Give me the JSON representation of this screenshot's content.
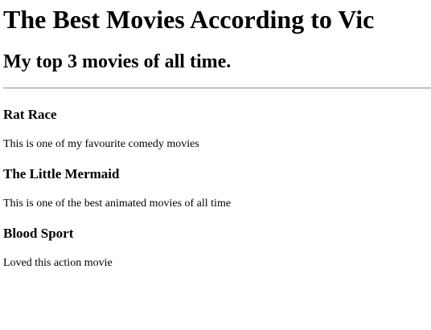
{
  "title": "The Best Movies According to Vic",
  "subtitle": "My top 3 movies of all time.",
  "movies": [
    {
      "name": "Rat Race",
      "desc": "This is one of my favourite comedy movies"
    },
    {
      "name": "The Little Mermaid",
      "desc": "This is one of the best animated movies of all time"
    },
    {
      "name": "Blood Sport",
      "desc": "Loved this action movie"
    }
  ]
}
